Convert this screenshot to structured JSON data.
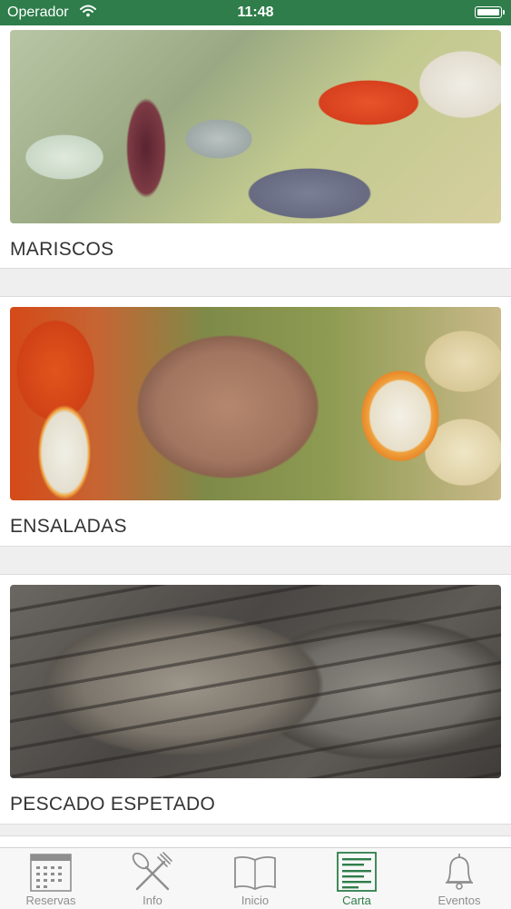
{
  "status_bar": {
    "carrier": "Operador",
    "time": "11:48"
  },
  "menu": {
    "items": [
      {
        "label": "MARISCOS"
      },
      {
        "label": "ENSALADAS"
      },
      {
        "label": "PESCADO ESPETADO"
      }
    ]
  },
  "tab_bar": {
    "active": "Carta",
    "active_color": "#2e7d4a",
    "inactive_color": "#8e8e8e",
    "tabs": [
      {
        "label": "Reservas",
        "icon": "calendar-icon"
      },
      {
        "label": "Info",
        "icon": "fork-knife-icon"
      },
      {
        "label": "Inicio",
        "icon": "book-icon"
      },
      {
        "label": "Carta",
        "icon": "menu-list-icon"
      },
      {
        "label": "Eventos",
        "icon": "bell-icon"
      }
    ]
  },
  "colors": {
    "status_bar": "#2e7d4a",
    "background": "#efefef"
  }
}
